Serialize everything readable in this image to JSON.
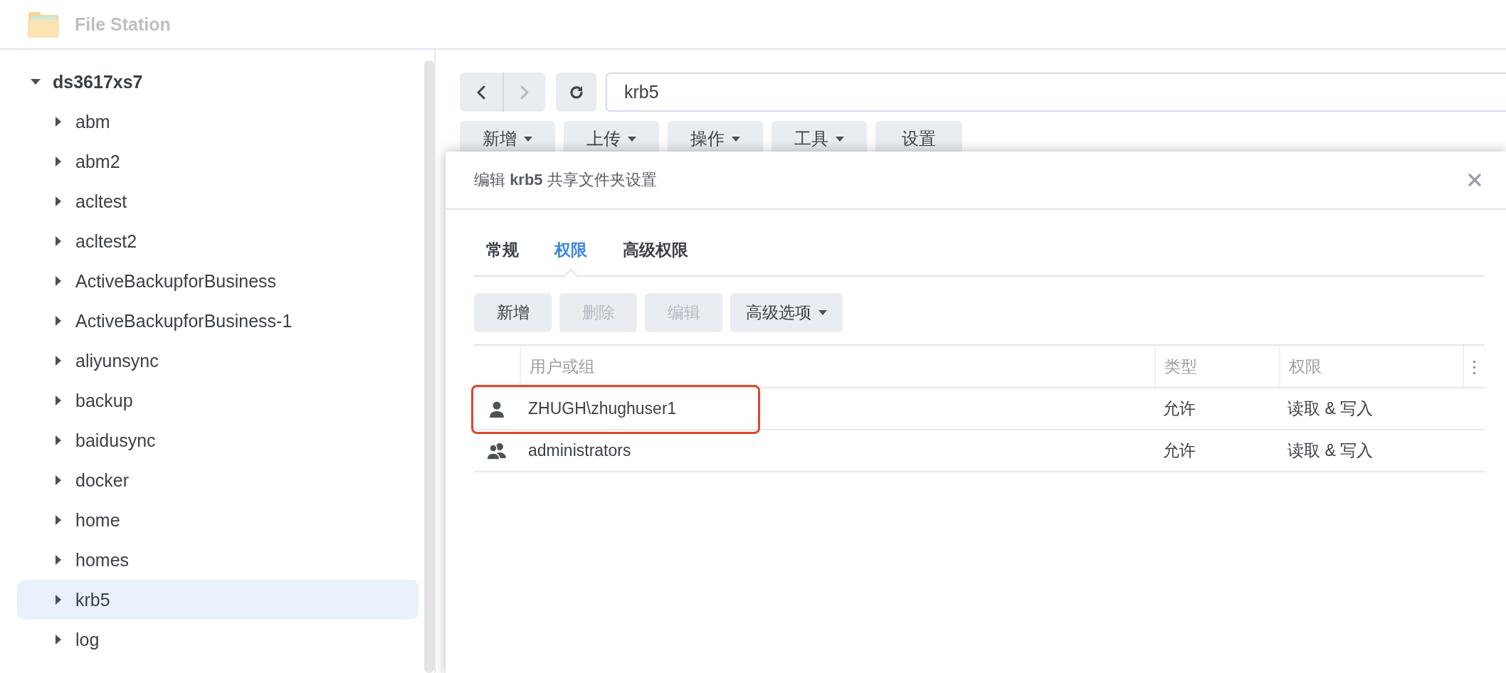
{
  "app": {
    "title": "File Station"
  },
  "tree": {
    "label": "ds3617xs7",
    "expanded": true,
    "children": [
      {
        "label": "abm",
        "expanded": false,
        "selected": false
      },
      {
        "label": "abm2",
        "expanded": false,
        "selected": false
      },
      {
        "label": "acltest",
        "expanded": false,
        "selected": false
      },
      {
        "label": "acltest2",
        "expanded": false,
        "selected": false
      },
      {
        "label": "ActiveBackupforBusiness",
        "expanded": false,
        "selected": false
      },
      {
        "label": "ActiveBackupforBusiness-1",
        "expanded": false,
        "selected": false
      },
      {
        "label": "aliyunsync",
        "expanded": false,
        "selected": false
      },
      {
        "label": "backup",
        "expanded": false,
        "selected": false
      },
      {
        "label": "baidusync",
        "expanded": false,
        "selected": false
      },
      {
        "label": "docker",
        "expanded": false,
        "selected": false
      },
      {
        "label": "home",
        "expanded": false,
        "selected": false
      },
      {
        "label": "homes",
        "expanded": false,
        "selected": false
      },
      {
        "label": "krb5",
        "expanded": false,
        "selected": true
      },
      {
        "label": "log",
        "expanded": false,
        "selected": false
      }
    ]
  },
  "navigation": {
    "back_disabled": false,
    "forward_disabled": true
  },
  "path_bar": {
    "value": "krb5"
  },
  "toolbar": [
    {
      "label": "新增",
      "dropdown": true
    },
    {
      "label": "上传",
      "dropdown": true
    },
    {
      "label": "操作",
      "dropdown": true
    },
    {
      "label": "工具",
      "dropdown": true
    },
    {
      "label": "设置",
      "dropdown": false
    }
  ],
  "dialog": {
    "title": "编辑 **krb5** 共享文件夹设置",
    "tabs": [
      {
        "label": "常规",
        "selected": false
      },
      {
        "label": "权限",
        "selected": true
      },
      {
        "label": "高级权限",
        "selected": false
      }
    ],
    "buttons": [
      {
        "label": "新增",
        "disabled": false,
        "dropdown": false
      },
      {
        "label": "删除",
        "disabled": true,
        "dropdown": false
      },
      {
        "label": "编辑",
        "disabled": true,
        "dropdown": false
      },
      {
        "label": "高级选项",
        "disabled": false,
        "dropdown": true
      }
    ],
    "table": {
      "columns": [
        "用户或组",
        "类型",
        "权限"
      ],
      "column_menu": "⋮",
      "rows": [
        {
          "kind": "user",
          "name": "ZHUGH\\zhughuser1",
          "type": "允许",
          "permission": "读取 & 写入",
          "highlighted": true
        },
        {
          "kind": "group",
          "name": "administrators",
          "type": "允许",
          "permission": "读取 & 写入",
          "highlighted": false
        }
      ]
    }
  }
}
